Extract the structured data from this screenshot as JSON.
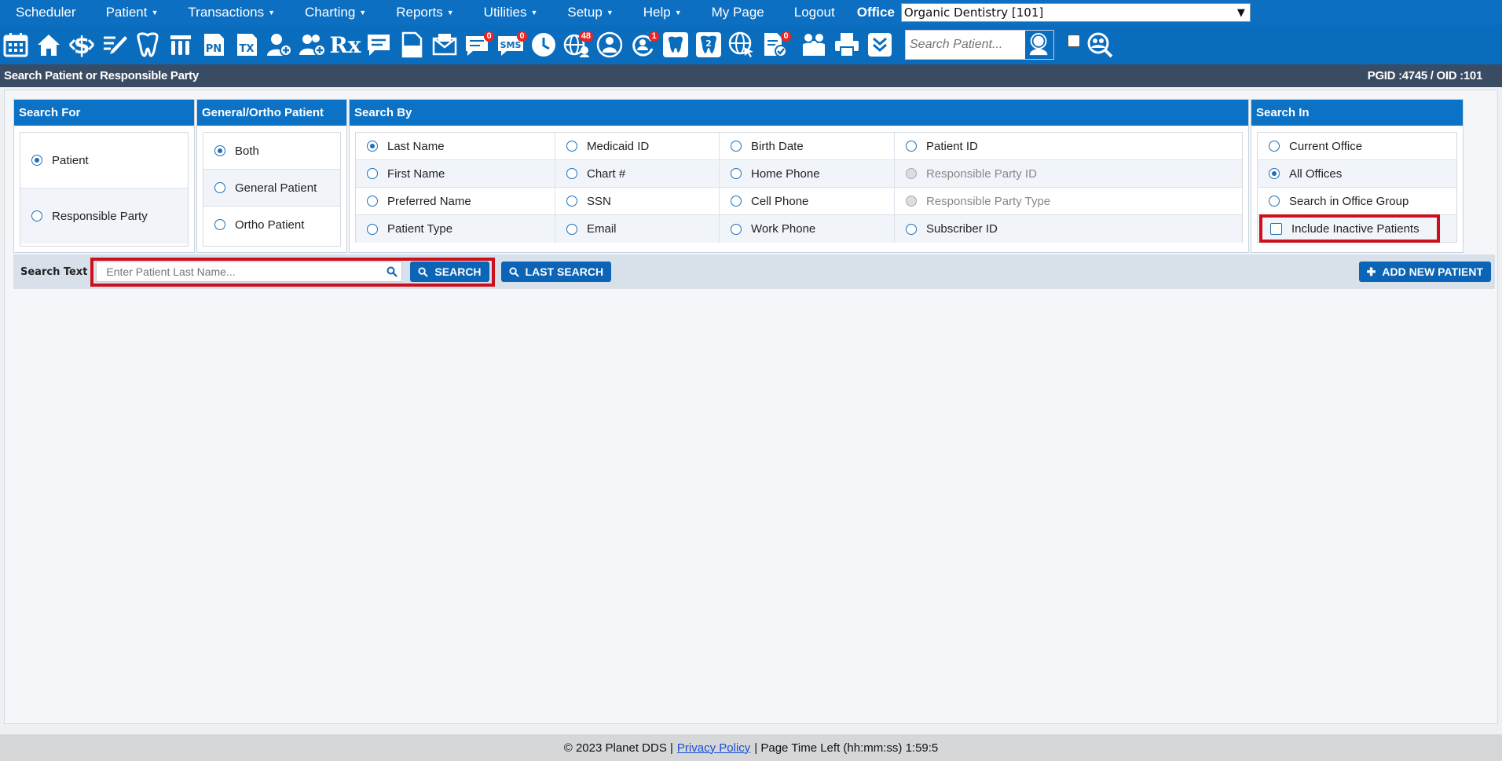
{
  "topnav": {
    "items": [
      {
        "label": "Scheduler",
        "dropdown": false
      },
      {
        "label": "Patient",
        "dropdown": true
      },
      {
        "label": "Transactions",
        "dropdown": true
      },
      {
        "label": "Charting",
        "dropdown": true
      },
      {
        "label": "Reports",
        "dropdown": true
      },
      {
        "label": "Utilities",
        "dropdown": true
      },
      {
        "label": "Setup",
        "dropdown": true
      },
      {
        "label": "Help",
        "dropdown": true
      },
      {
        "label": "My Page",
        "dropdown": false
      },
      {
        "label": "Logout",
        "dropdown": false
      }
    ],
    "caret": "▼",
    "office_label": "Office",
    "office_value": "Organic Dentistry [101]"
  },
  "toolbar": {
    "badges": {
      "messages": "0",
      "sms": "0",
      "web": "48",
      "recall": "1",
      "docs": "0"
    },
    "sms_text": "SMS",
    "pn_text": "PN",
    "tx_text": "TX",
    "rx_text": "Rx",
    "tooth_two_text": "2",
    "search_placeholder": "Search Patient..."
  },
  "titlebar": {
    "title": "Search Patient or Responsible Party",
    "ids": "PGID :4745  /  OID :101"
  },
  "search_for": {
    "header": "Search For",
    "options": [
      "Patient",
      "Responsible Party"
    ]
  },
  "general_ortho": {
    "header": "General/Ortho Patient",
    "options": [
      "Both",
      "General Patient",
      "Ortho Patient"
    ]
  },
  "search_by": {
    "header": "Search By",
    "columns": [
      [
        "Last Name",
        "First Name",
        "Preferred Name",
        "Patient Type"
      ],
      [
        "Medicaid ID",
        "Chart #",
        "SSN",
        "Email"
      ],
      [
        "Birth Date",
        "Home Phone",
        "Cell Phone",
        "Work Phone"
      ],
      [
        "Patient ID",
        "Responsible Party ID",
        "Responsible Party Type",
        "Subscriber ID"
      ]
    ]
  },
  "search_in": {
    "header": "Search In",
    "options": [
      "Current Office",
      "All Offices",
      "Search in Office Group"
    ],
    "inactive_label": "Include Inactive Patients"
  },
  "searchbar": {
    "label": "Search Text",
    "placeholder": "Enter Patient Last Name...",
    "search_button": "SEARCH",
    "last_search_button": "LAST SEARCH",
    "add_button": "ADD NEW PATIENT"
  },
  "footer": {
    "copyright": "© 2023 Planet DDS |",
    "privacy": "Privacy Policy",
    "time_left": "|  Page Time Left (hh:mm:ss) 1:59:5"
  },
  "colors": {
    "nav": "#0c6fc2",
    "titlebar": "#3a4b64",
    "highlight": "#cc0f1d"
  }
}
